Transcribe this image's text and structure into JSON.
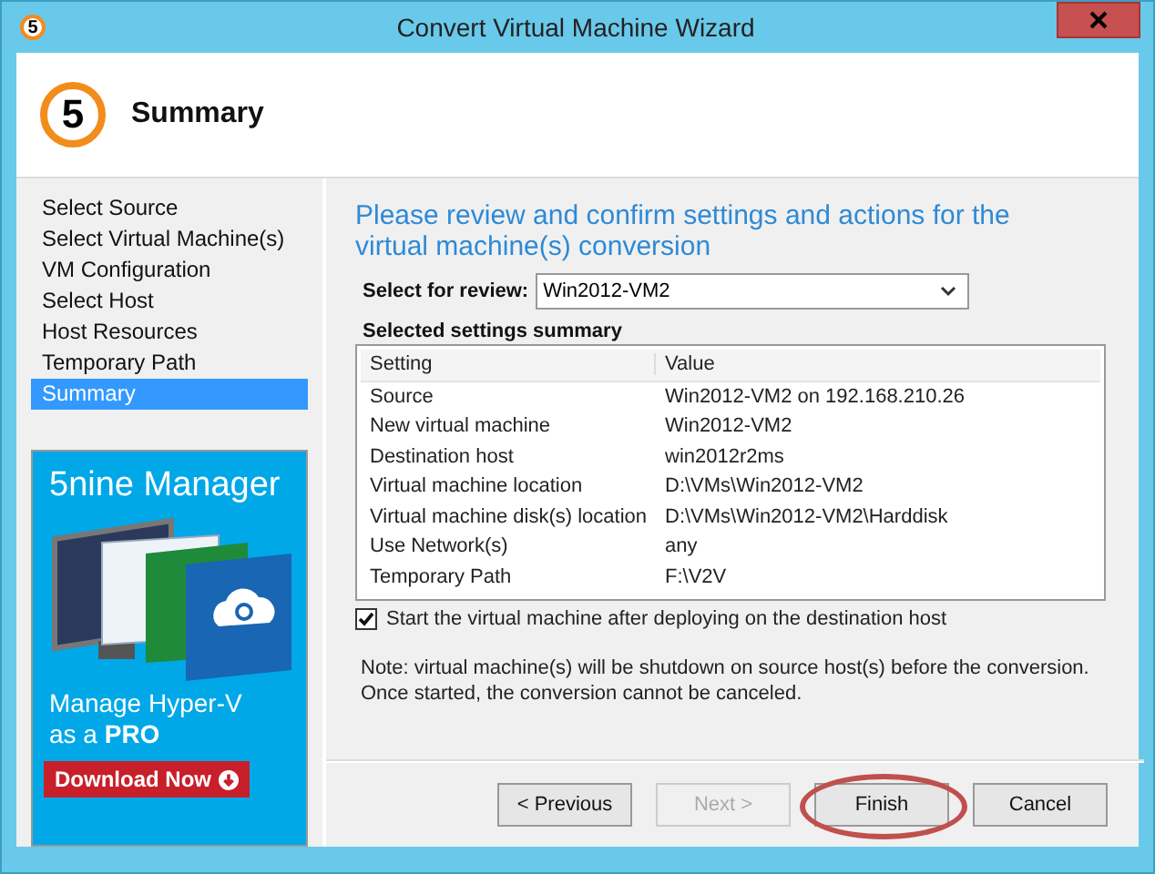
{
  "window": {
    "title": "Convert Virtual Machine Wizard",
    "step_number": "5"
  },
  "header": {
    "step_number": "5",
    "title": "Summary"
  },
  "sidebar": {
    "items": [
      {
        "label": "Select Source",
        "selected": false
      },
      {
        "label": "Select Virtual Machine(s)",
        "selected": false
      },
      {
        "label": "VM Configuration",
        "selected": false
      },
      {
        "label": "Select Host",
        "selected": false
      },
      {
        "label": "Host Resources",
        "selected": false
      },
      {
        "label": "Temporary Path",
        "selected": false
      },
      {
        "label": "Summary",
        "selected": true
      }
    ]
  },
  "banner": {
    "title": "5nine Manager",
    "tagline": "Manage Hyper-V as a **PRO**",
    "button": "Download Now"
  },
  "main": {
    "heading": "Please review and confirm settings and actions for the virtual machine(s) conversion",
    "select_label": "Select for review:",
    "select_value": "Win2012-VM2",
    "summary_title": "Selected settings summary",
    "table": {
      "columns": [
        "Setting",
        "Value"
      ],
      "rows": [
        [
          "Source",
          "Win2012-VM2 on 192.168.210.26"
        ],
        [
          "New virtual machine",
          "Win2012-VM2"
        ],
        [
          "Destination host",
          "win2012r2ms"
        ],
        [
          "Virtual machine location",
          "D:\\VMs\\Win2012-VM2"
        ],
        [
          "Virtual machine disk(s) location",
          "D:\\VMs\\Win2012-VM2\\Harddisk"
        ],
        [
          "Use Network(s)",
          "any"
        ],
        [
          "Temporary Path",
          "F:\\V2V"
        ]
      ]
    },
    "checkbox": {
      "label": "Start the virtual machine after deploying on the destination host",
      "checked": true
    },
    "note": "Note: virtual machine(s) will be shutdown on source host(s) before the conversion. Once started, the conversion cannot be canceled."
  },
  "buttons": [
    {
      "label": "< Previous",
      "disabled": false,
      "circled": false
    },
    {
      "label": "Next >",
      "disabled": true,
      "circled": false
    },
    {
      "label": "Finish",
      "disabled": false,
      "circled": true
    },
    {
      "label": "Cancel",
      "disabled": false,
      "circled": false
    }
  ]
}
